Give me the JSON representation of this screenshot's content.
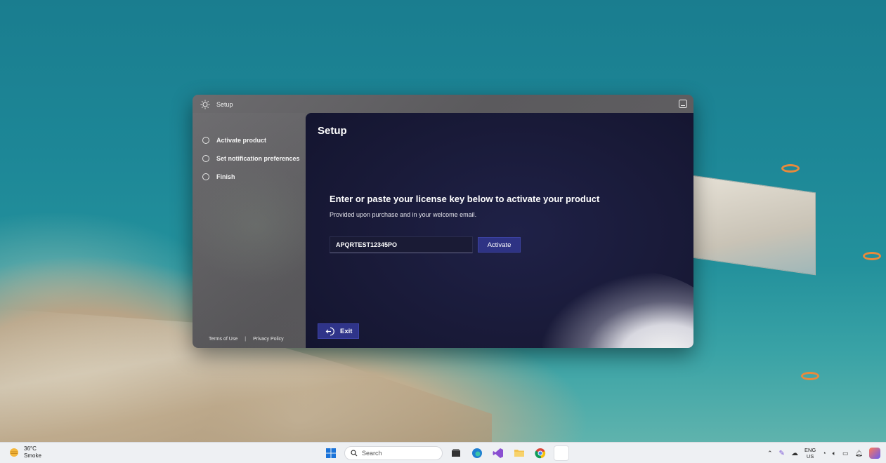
{
  "window": {
    "title": "Setup",
    "steps": [
      {
        "label": "Activate product"
      },
      {
        "label": "Set notification preferences"
      },
      {
        "label": "Finish"
      }
    ],
    "footer": {
      "terms": "Terms of Use",
      "separator": "|",
      "privacy": "Privacy Policy"
    },
    "main": {
      "title": "Setup",
      "heading": "Enter or paste your license key below to activate your product",
      "subheading": "Provided upon purchase and in your welcome email.",
      "license_value": "APQRTEST12345PO",
      "activate_label": "Activate",
      "exit_label": "Exit"
    }
  },
  "taskbar": {
    "weather_temp": "36°C",
    "weather_desc": "Smoke",
    "search_label": "Search",
    "lang_top": "ENG",
    "lang_bottom": "US",
    "icons": [
      "start-icon",
      "search-icon",
      "file-explorer-icon",
      "edge-icon",
      "visual-studio-icon",
      "folder-icon",
      "chrome-icon"
    ]
  },
  "colors": {
    "accent": "#2f3489",
    "main_bg": "#191a38",
    "sidebar_bg": "#5f5e61"
  }
}
